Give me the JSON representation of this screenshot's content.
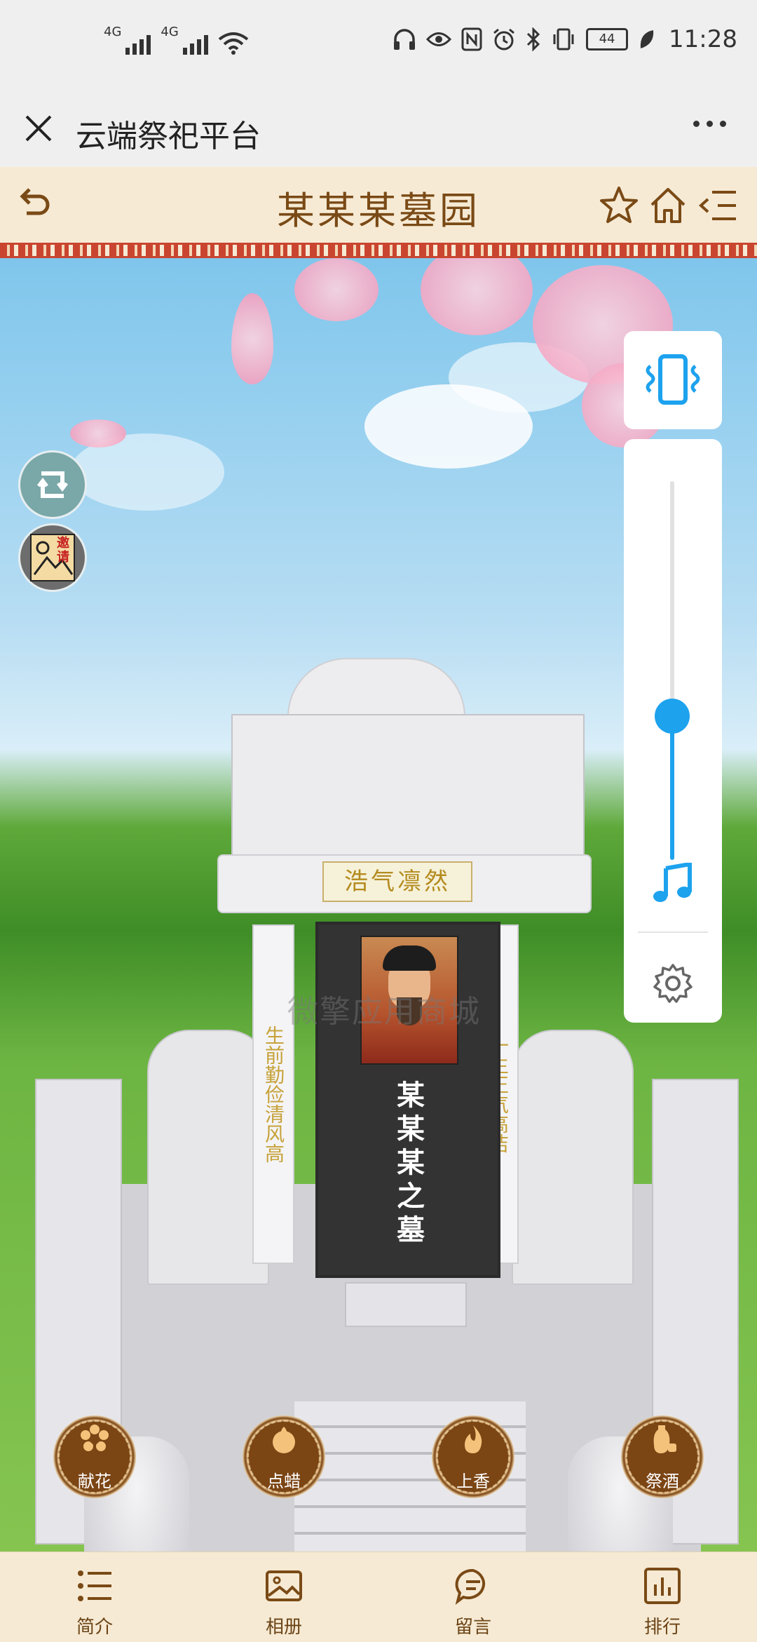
{
  "status_bar": {
    "network_1": "4G",
    "network_2": "4G",
    "battery_level": "44",
    "time": "11:28"
  },
  "wechat_bar": {
    "title": "云端祭祀平台"
  },
  "header": {
    "title": "某某某墓园"
  },
  "tomb": {
    "plaque_text": "浩气凛然",
    "left_couplet": "生前勤俭清风高",
    "right_couplet": "一生正气高洁",
    "name": "某某某之墓",
    "watermark": "微擎应用商城"
  },
  "invite_label": "邀请",
  "volume": {
    "level": 0.33
  },
  "actions": [
    {
      "label": "献花",
      "icon": "flower-icon"
    },
    {
      "label": "点蜡",
      "icon": "candle-icon"
    },
    {
      "label": "上香",
      "icon": "flame-icon"
    },
    {
      "label": "祭酒",
      "icon": "wine-icon"
    }
  ],
  "tabs": [
    {
      "label": "简介",
      "icon": "list-icon"
    },
    {
      "label": "相册",
      "icon": "image-icon"
    },
    {
      "label": "留言",
      "icon": "message-icon"
    },
    {
      "label": "排行",
      "icon": "chart-icon"
    }
  ],
  "colors": {
    "header_bg": "#f6ead4",
    "brown": "#7a4a16",
    "accent_blue": "#1da2ee"
  }
}
